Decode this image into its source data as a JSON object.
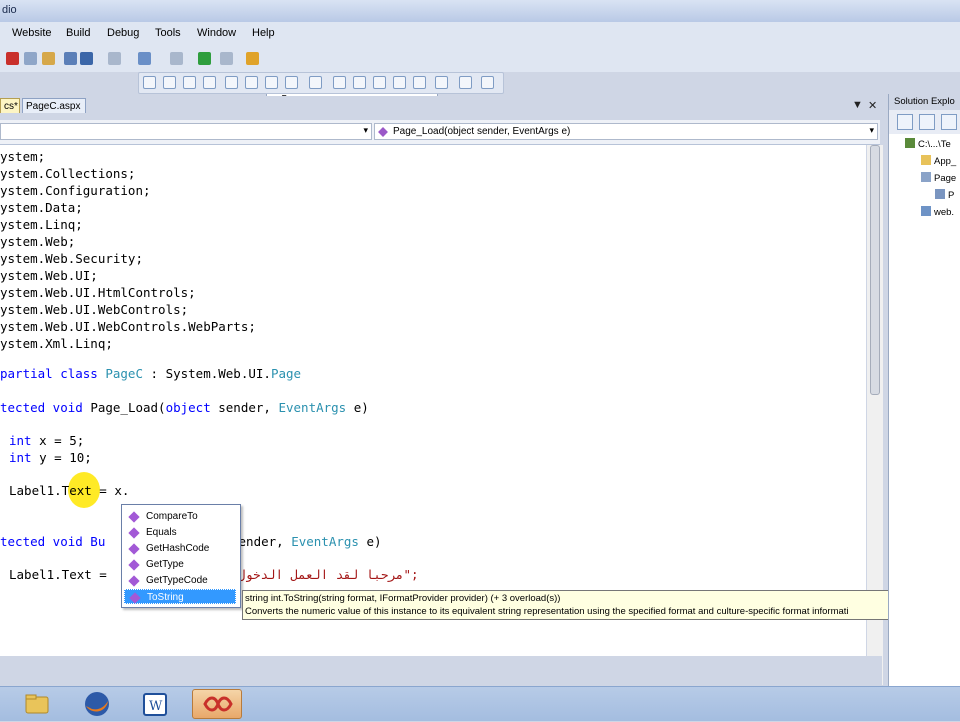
{
  "window": {
    "title": "dio"
  },
  "menu": {
    "items": [
      "Website",
      "Build",
      "Debug",
      "Tools",
      "Window",
      "Help"
    ]
  },
  "toolbar": {
    "config_value": "uc5"
  },
  "tabs": [
    {
      "label": "cs*"
    },
    {
      "label": "PageC.aspx"
    }
  ],
  "nav": {
    "member": "Page_Load(object sender, EventArgs e)"
  },
  "code": {
    "lines": [
      "ystem;",
      "ystem.Collections;",
      "ystem.Configuration;",
      "ystem.Data;",
      "ystem.Linq;",
      "ystem.Web;",
      "ystem.Web.Security;",
      "ystem.Web.UI;",
      "ystem.Web.UI.HtmlControls;",
      "ystem.Web.UI.WebControls;",
      "ystem.Web.UI.WebControls.WebParts;",
      "ystem.Xml.Linq;"
    ],
    "class_line": {
      "kw": "partial class ",
      "name": "PageC",
      "mid": " : System.Web.UI.",
      "base": "Page"
    },
    "method1": {
      "kw": "tected void ",
      "rest": "Page_Load(",
      "kw2": "object",
      "mid": " sender, ",
      "type": "EventArgs",
      "end": " e)"
    },
    "var_x": {
      "kw": "int",
      "rest": " x = 5;"
    },
    "var_y": {
      "kw": "int",
      "rest": " y = 10;"
    },
    "assign1": "Label1.Text = x.",
    "method2": {
      "kw": "tected void Bu",
      "rest": "ject sender, ",
      "type": "EventArgs",
      "end": " e)"
    },
    "assign2": {
      "pre": "Label1.Text = ",
      "str": "\"مرحبا لقد العمل الدخول\";"
    }
  },
  "intellisense": {
    "items": [
      "CompareTo",
      "Equals",
      "GetHashCode",
      "GetType",
      "GetTypeCode",
      "ToString"
    ],
    "selected": "ToString"
  },
  "tooltip": {
    "signature": "string int.ToString(string format, IFormatProvider provider)  (+ 3 overload(s))",
    "description": "Converts the numeric value of this instance to its equivalent string representation using the specified format and culture-specific format informati"
  },
  "solution_explorer": {
    "title": "Solution Explo",
    "nodes": [
      "C:\\...\\Te",
      "App_",
      "Page",
      "P",
      "web."
    ]
  },
  "colors": {
    "keyword": "#0000ff",
    "type": "#2b91af",
    "string": "#a31515",
    "selection": "#3399ff"
  }
}
